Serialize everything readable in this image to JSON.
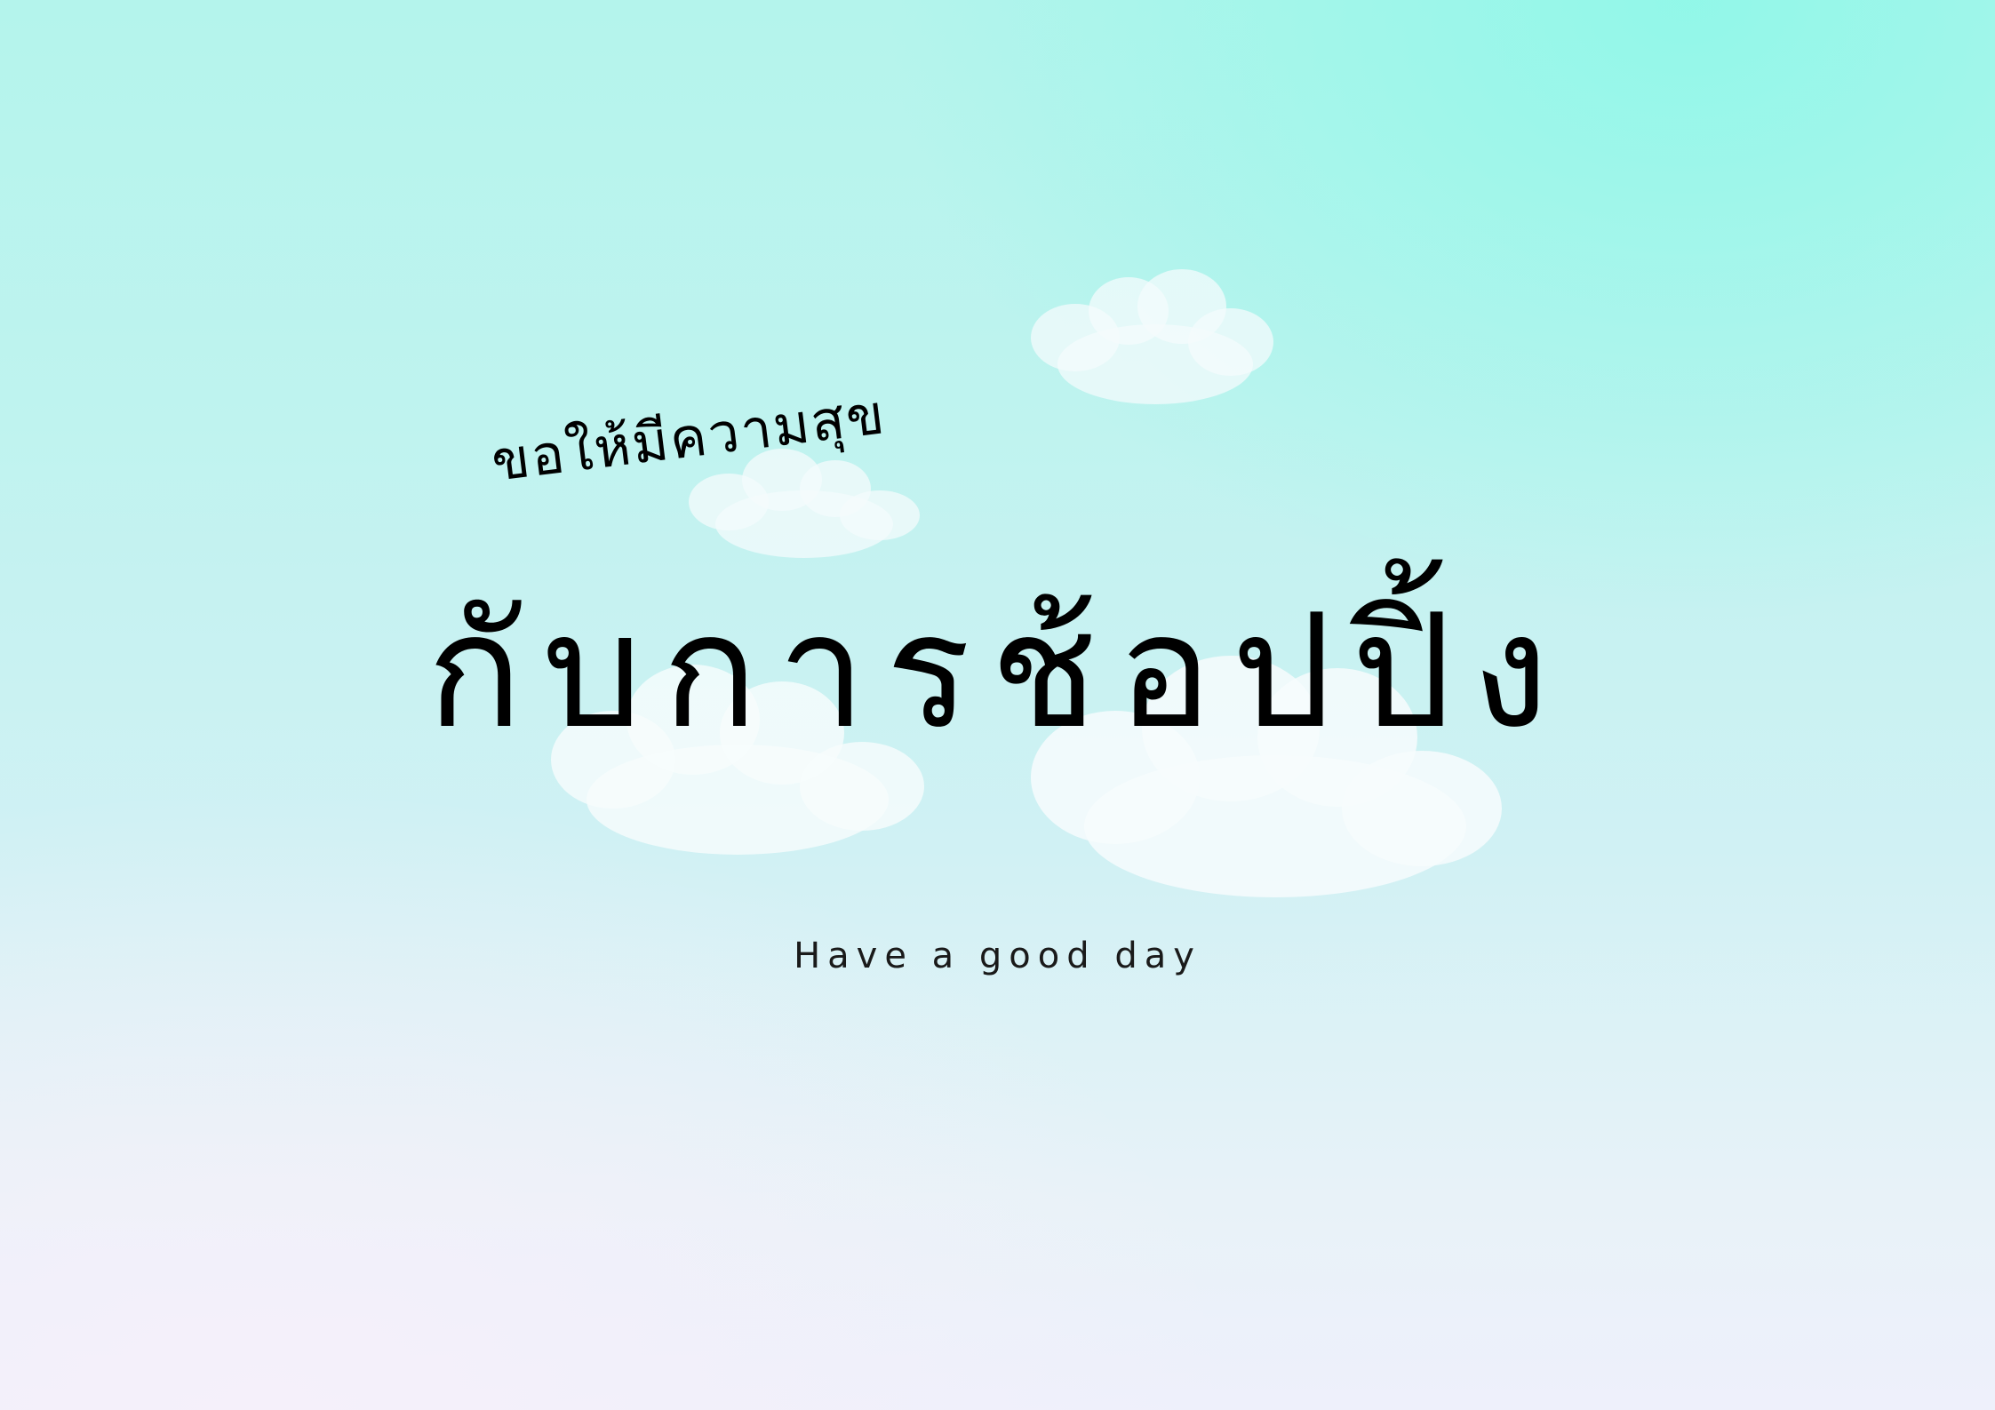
{
  "card": {
    "headline": "ขอให้มีความสุข",
    "title": "กับการช้อปปิ้ง",
    "subtitle": "Have a good day"
  },
  "decorations": {
    "cloud_icon": "cloud-icon",
    "cloud_color": "#f7fcfd",
    "text_color": "#000000"
  }
}
